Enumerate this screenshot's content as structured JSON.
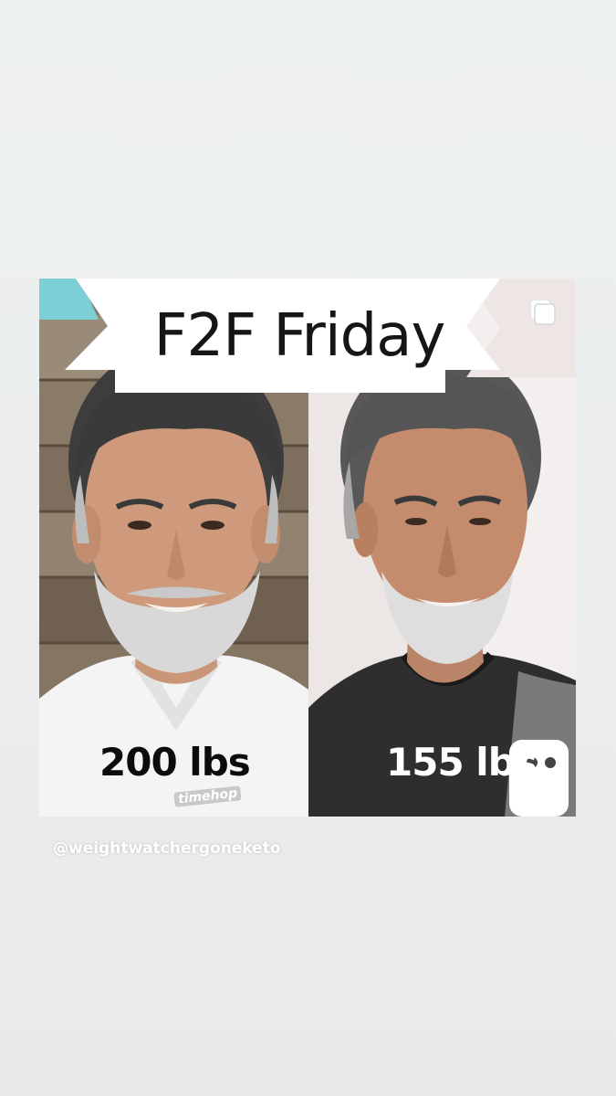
{
  "post": {
    "title": "F2F Friday",
    "accent_color": "#7dcfd6",
    "before": {
      "weight_label": "200 lbs",
      "watermark": "timehop"
    },
    "after": {
      "weight_label": "155 lbs"
    },
    "multi_post_icon": "multiple-images-icon"
  },
  "story": {
    "mention": "@weightwatchergoneketo"
  }
}
